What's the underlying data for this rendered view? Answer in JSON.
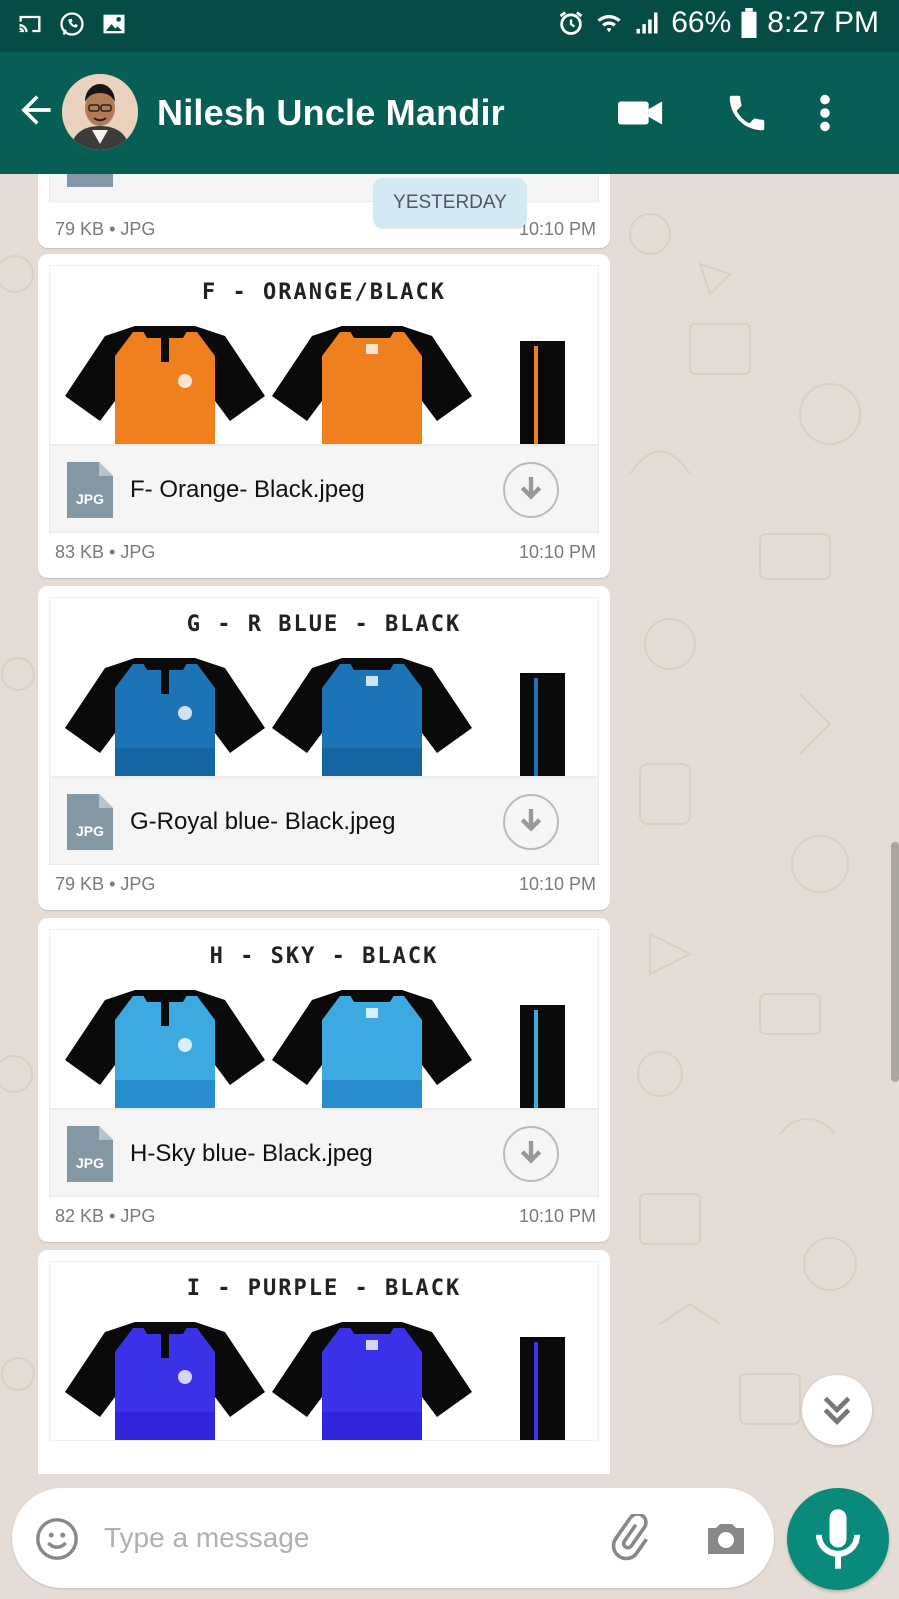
{
  "status_bar": {
    "battery": "66%",
    "time": "8:27 PM",
    "left_icons": [
      "cast-icon",
      "whatsapp-icon",
      "gallery-icon"
    ],
    "right_icons": [
      "alarm-icon",
      "wifi-icon",
      "signal-icon",
      "battery-icon"
    ]
  },
  "header": {
    "contact_name": "Nilesh Uncle Mandir",
    "icons": [
      "back-arrow-icon",
      "video-call-icon",
      "phone-call-icon",
      "more-options-icon"
    ]
  },
  "date_chip": "YESTERDAY",
  "messages": [
    {
      "size": "79 KB",
      "sep": "•",
      "type": "JPG",
      "time": "10:10 PM",
      "icon": "jpg-file-icon"
    },
    {
      "preview_title": "F - ORANGE/BLACK",
      "filename": "F- Orange- Black.jpeg",
      "file_icon_label": "JPG",
      "size": "83 KB",
      "sep": "•",
      "type": "JPG",
      "time": "10:10 PM",
      "shirt_color": "#f07f1e",
      "shirt_color_dark": "#f07f1e"
    },
    {
      "preview_title": "G - R BLUE - BLACK",
      "filename": "G-Royal blue- Black.jpeg",
      "file_icon_label": "JPG",
      "size": "79 KB",
      "sep": "•",
      "type": "JPG",
      "time": "10:10 PM",
      "shirt_color": "#1c73b6",
      "shirt_color_dark": "#125b96"
    },
    {
      "preview_title": "H - SKY - BLACK",
      "filename": "H-Sky blue- Black.jpeg",
      "file_icon_label": "JPG",
      "size": "82 KB",
      "sep": "•",
      "type": "JPG",
      "time": "10:10 PM",
      "shirt_color": "#3ca9e0",
      "shirt_color_dark": "#1a7cbf"
    },
    {
      "preview_title": "I - PURPLE - BLACK",
      "shirt_color": "#3b31e8",
      "shirt_color_dark": "#2a1ed0"
    }
  ],
  "composer": {
    "placeholder": "Type a message",
    "icons": [
      "emoji-icon",
      "attach-icon",
      "camera-icon",
      "mic-icon"
    ]
  },
  "colors": {
    "header": "#075e54",
    "status_bar": "#054d44",
    "chat_bg": "#e5ddd5",
    "mic_button": "#0a8a7b",
    "date_chip": "#d3e9f3"
  }
}
